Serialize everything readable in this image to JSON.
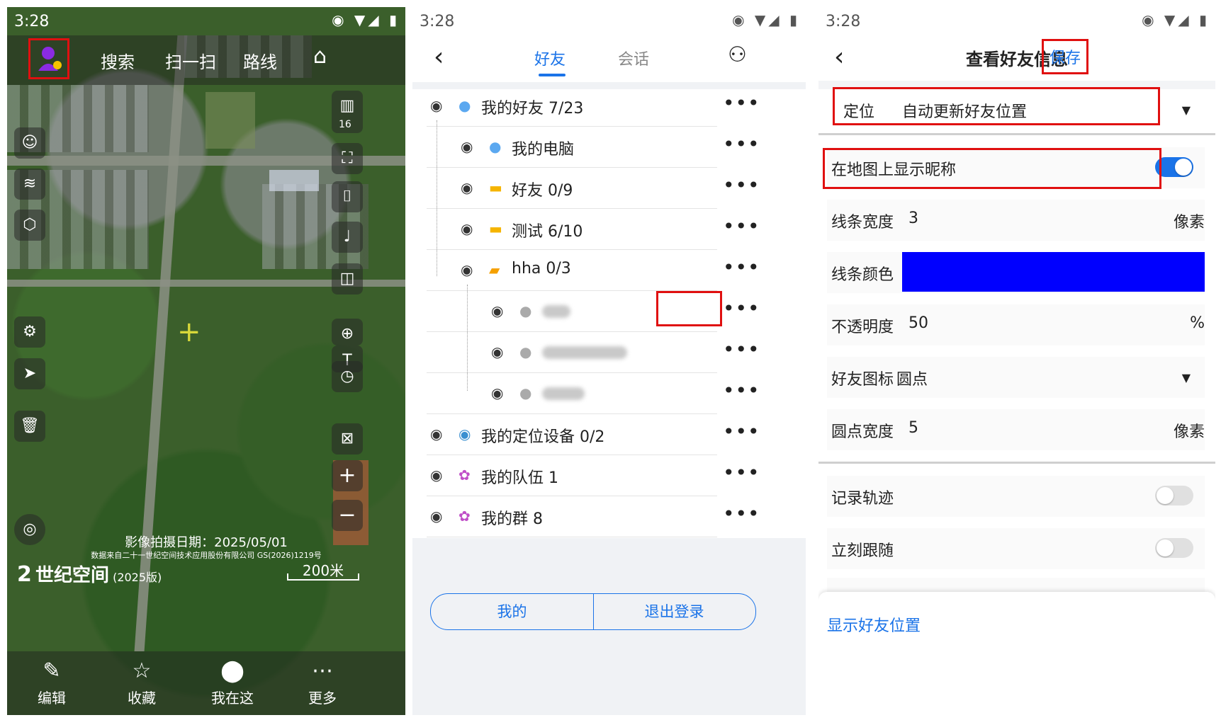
{
  "status": {
    "time": "3:28",
    "right": "◉ ▼◢ ▮"
  },
  "map_screen": {
    "top_nav": [
      "搜索",
      "扫一扫",
      "路线"
    ],
    "zoom_level": "16",
    "capture_date": "影像拍摄日期：2025/05/01",
    "data_source": "数据来自二十一世纪空间技术应用股份有限公司 GS(2026)1219号",
    "brand_name": "世纪空间",
    "brand_edition": "(2025版)",
    "scale": "200米",
    "bottom_nav": [
      "编辑",
      "收藏",
      "我在这",
      "更多"
    ]
  },
  "friends_screen": {
    "tabs": [
      "好友",
      "会话"
    ],
    "rows": [
      {
        "label": "我的好友 7/23",
        "icon": "person-icon"
      },
      {
        "label": "我的电脑",
        "icon": "person-icon"
      },
      {
        "label": "好友 0/9",
        "icon": "folder-icon"
      },
      {
        "label": "测试 6/10",
        "icon": "folder-icon"
      },
      {
        "label": "hha 0/3",
        "icon": "folder-open-icon"
      },
      {
        "label": "",
        "icon": "gray-person-icon"
      },
      {
        "label": "",
        "icon": "gray-person-icon"
      },
      {
        "label": "",
        "icon": "gray-person-icon"
      },
      {
        "label": "我的定位设备 0/2",
        "icon": "location-icon"
      },
      {
        "label": "我的队伍 1",
        "icon": "team-icon"
      },
      {
        "label": "我的群 8",
        "icon": "team-icon"
      }
    ],
    "buttons": [
      "我的",
      "退出登录"
    ],
    "more_glyph": "•••"
  },
  "settings_screen": {
    "title": "查看好友信息",
    "save": "保存",
    "locate_label": "定位",
    "locate_value": "自动更新好友位置",
    "show_nickname": "在地图上显示昵称",
    "show_nickname_on": true,
    "line_width_label": "线条宽度",
    "line_width": "3",
    "line_width_unit": "像素",
    "line_color_label": "线条颜色",
    "line_color": "#0000ff",
    "opacity_label": "不透明度",
    "opacity": "50",
    "opacity_unit": "%",
    "icon_label": "好友图标",
    "icon_value": "圆点",
    "dot_width_label": "圆点宽度",
    "dot_width": "5",
    "dot_width_unit": "像素",
    "record_track": "记录轨迹",
    "record_track_on": false,
    "follow_now": "立刻跟随",
    "follow_now_on": false,
    "show_position_link": "显示好友位置"
  },
  "colors": {
    "accent": "#1a73e8",
    "highlight": "#e01010",
    "toggle_on": "#1a73e8"
  }
}
